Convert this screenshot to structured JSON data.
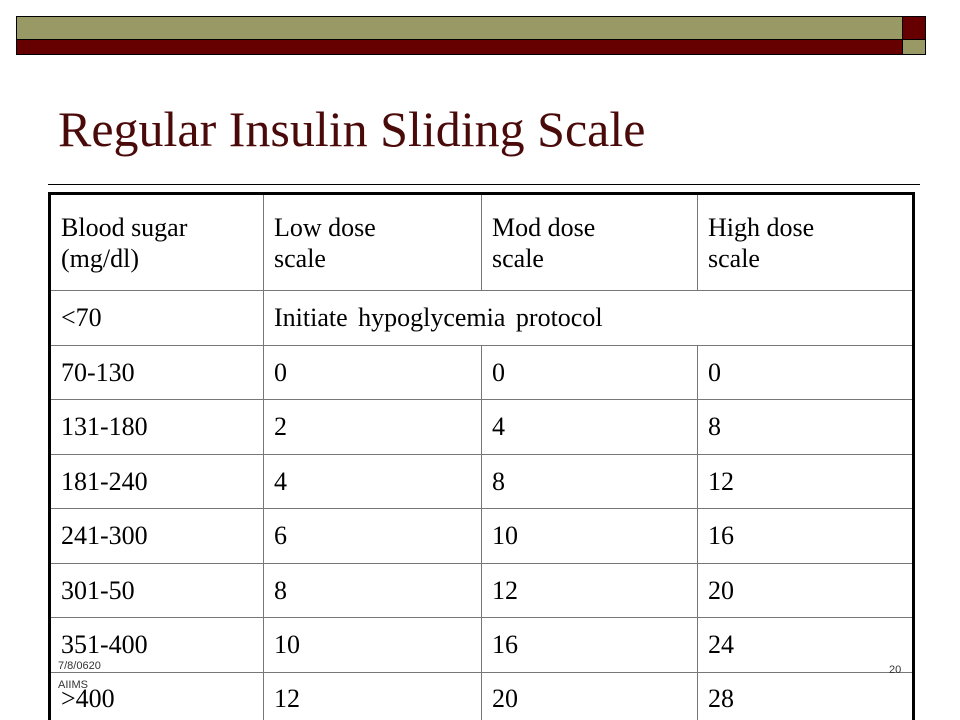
{
  "slide": {
    "title": "Regular Insulin Sliding Scale",
    "colors": {
      "accent_olive": "#999966",
      "accent_maroon": "#660000",
      "title": "#4a0a0a"
    }
  },
  "table": {
    "headers": [
      "Blood sugar (mg/dl)",
      "Low dose scale",
      "Mod dose scale",
      "High dose scale"
    ],
    "header_lines": [
      [
        "Blood sugar",
        "(mg/dl)"
      ],
      [
        "Low dose",
        "scale"
      ],
      [
        "Mod dose",
        "scale"
      ],
      [
        "High dose",
        "scale"
      ]
    ],
    "hypoglycemia_row": {
      "range": "<70",
      "note": "Initiate hypoglycemia protocol"
    },
    "rows": [
      {
        "range": "70-130",
        "low": "0",
        "mod": "0",
        "high": "0"
      },
      {
        "range": "131-180",
        "low": "2",
        "mod": "4",
        "high": "8"
      },
      {
        "range": "181-240",
        "low": "4",
        "mod": "8",
        "high": "12"
      },
      {
        "range": "241-300",
        "low": "6",
        "mod": "10",
        "high": "16"
      },
      {
        "range": "301-50",
        "low": "8",
        "mod": "12",
        "high": "20"
      },
      {
        "range": "351-400",
        "low": "10",
        "mod": "16",
        "high": "24"
      },
      {
        "range": ">400",
        "low": "12",
        "mod": "20",
        "high": "28"
      }
    ]
  },
  "footer": {
    "date": "7/8/0620",
    "organization": "AIIMS",
    "page_number": "20"
  }
}
